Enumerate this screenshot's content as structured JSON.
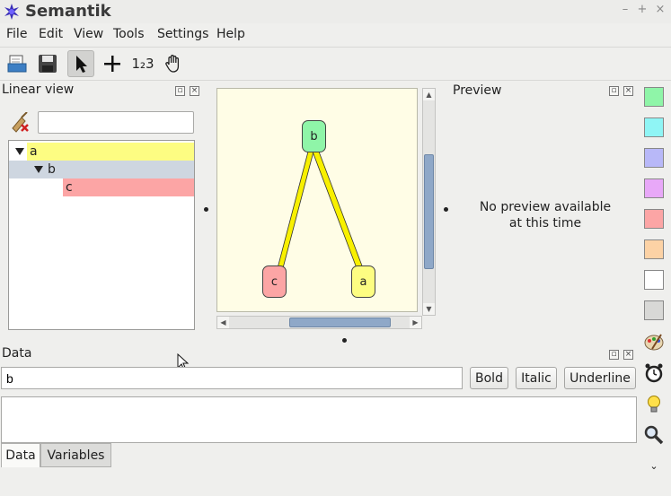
{
  "window": {
    "title": "Semantik"
  },
  "menu": [
    {
      "key": "file",
      "label": "File"
    },
    {
      "key": "edit",
      "label": "Edit"
    },
    {
      "key": "view",
      "label": "View"
    },
    {
      "key": "tools",
      "label": "Tools"
    },
    {
      "key": "settings",
      "label": "Settings"
    },
    {
      "key": "help",
      "label": "Help"
    }
  ],
  "toolbar": {
    "buttons": [
      "open-icon",
      "save-icon",
      "pointer-icon",
      "move-icon",
      "sort-icon",
      "hand-icon"
    ],
    "active": "pointer-icon",
    "sort_label": "1₂3"
  },
  "linear_view": {
    "title": "Linear view",
    "search_value": "",
    "items": [
      {
        "label": "a",
        "color": "#fdfd82",
        "level": 0,
        "expanded": true
      },
      {
        "label": "b",
        "color": "#ced6e0",
        "level": 1,
        "expanded": true
      },
      {
        "label": "c",
        "color": "#fca5a5",
        "level": 2,
        "expanded": false
      }
    ]
  },
  "map": {
    "nodes": [
      {
        "label": "b",
        "color": "#8ff5a8"
      },
      {
        "label": "c",
        "color": "#fca5a5"
      },
      {
        "label": "a",
        "color": "#fdfd82"
      }
    ],
    "edge_color": "#f8f000"
  },
  "preview": {
    "title": "Preview",
    "message_line1": "No preview available",
    "message_line2": "at this time"
  },
  "palette": [
    "#8ff5a8",
    "#8ff5f5",
    "#b8b8f8",
    "#e8a8f8",
    "#fca5a5",
    "#fcd2a5",
    "#ffffff",
    "#d8d8d6"
  ],
  "side_icons": [
    "paint-icon",
    "alarm-icon",
    "bulb-icon",
    "search-icon",
    "chevron-down-icon"
  ],
  "data_panel": {
    "title": "Data",
    "text_value": "b",
    "bold": "Bold",
    "italic": "Italic",
    "underline": "Underline",
    "tabs": [
      {
        "label": "Data",
        "active": true
      },
      {
        "label": "Variables",
        "active": false
      }
    ]
  }
}
